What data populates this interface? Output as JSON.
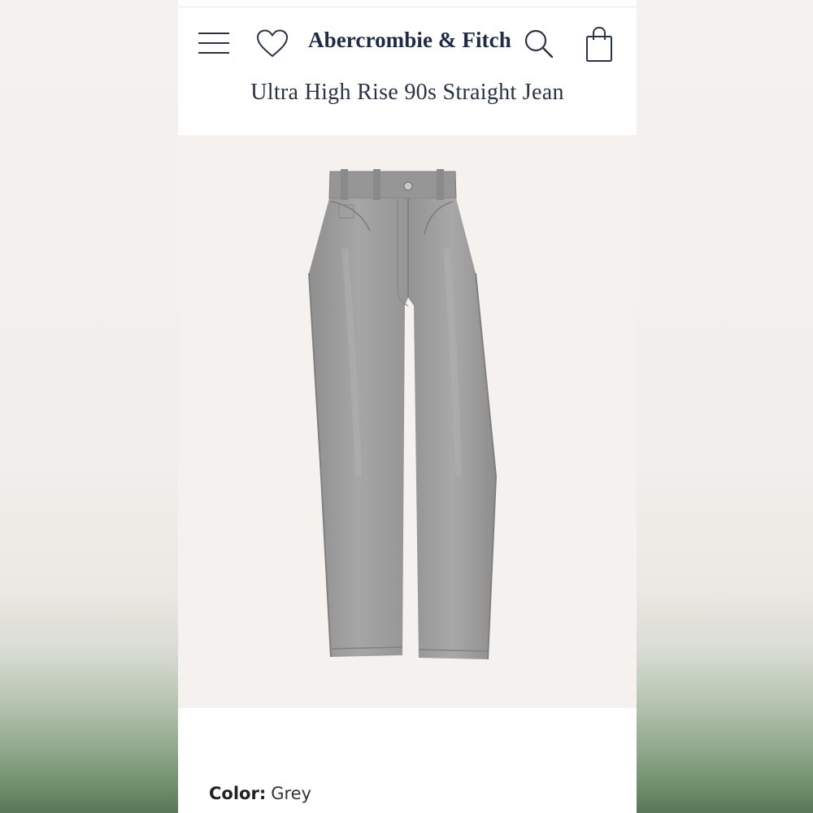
{
  "header": {
    "brand": "Abercrombie & Fitch",
    "icons": {
      "menu": "hamburger-menu-icon",
      "wishlist": "heart-icon",
      "search": "search-icon",
      "bag": "shopping-bag-icon"
    }
  },
  "product": {
    "title": "Ultra High Rise 90s Straight Jean",
    "image_alt": "grey straight-leg jeans",
    "color_label": "Color:",
    "color_value": "Grey"
  },
  "colors": {
    "brand_navy": "#1f2a44",
    "image_bg": "#f5f1ef",
    "denim_grey": "#9a9a9a"
  }
}
